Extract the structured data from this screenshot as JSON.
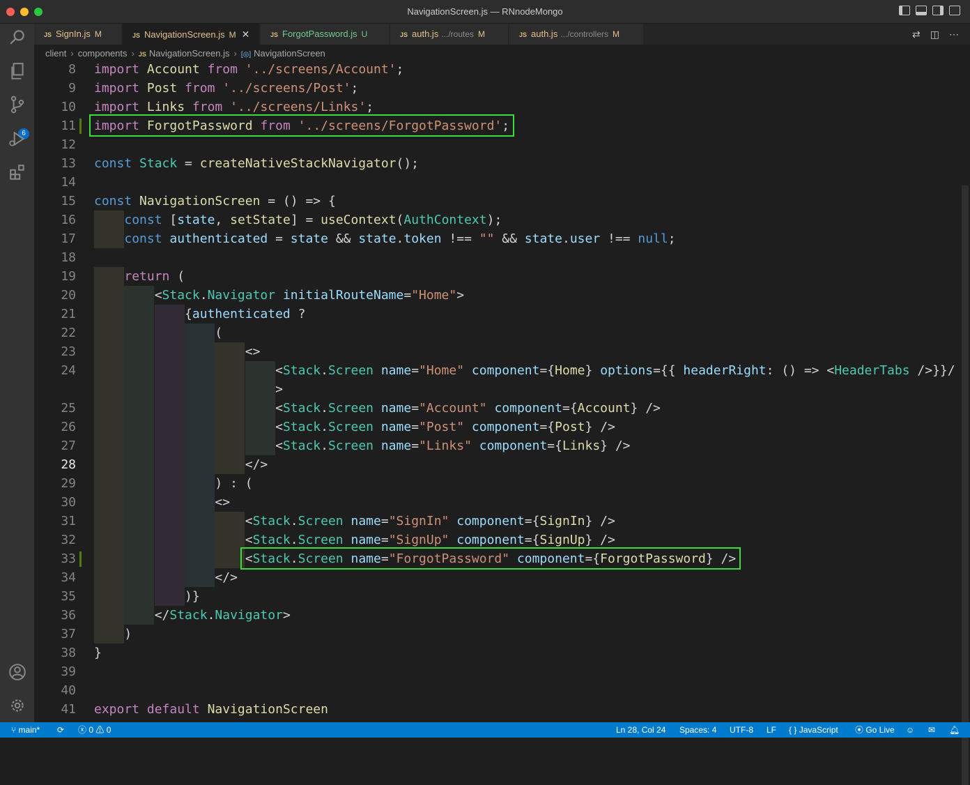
{
  "window": {
    "title": "NavigationScreen.js — RNnodeMongo"
  },
  "activity": {
    "scm_badge": "6"
  },
  "tabs": [
    {
      "name": "SignIn.js",
      "dir": "",
      "status": "M"
    },
    {
      "name": "NavigationScreen.js",
      "dir": "",
      "status": "M"
    },
    {
      "name": "ForgotPassword.js",
      "dir": "",
      "status": "U"
    },
    {
      "name": "auth.js",
      "dir": ".../routes",
      "status": "M"
    },
    {
      "name": "auth.js",
      "dir": ".../controllers",
      "status": "M"
    }
  ],
  "breadcrumb": {
    "folder1": "client",
    "folder2": "components",
    "file": "NavigationScreen.js",
    "symbol": "NavigationScreen"
  },
  "editor": {
    "line_numbers": [
      "8",
      "9",
      "10",
      "11",
      "12",
      "13",
      "14",
      "15",
      "16",
      "17",
      "18",
      "19",
      "20",
      "21",
      "22",
      "23",
      "24",
      "",
      "25",
      "26",
      "27",
      "28",
      "29",
      "30",
      "31",
      "32",
      "33",
      "34",
      "35",
      "36",
      "37",
      "38",
      "39",
      "40",
      "41"
    ],
    "lines": [
      "import Account from '../screens/Account';",
      "import Post from '../screens/Post';",
      "import Links from '../screens/Links';",
      "import ForgotPassword from '../screens/ForgotPassword';",
      "",
      "const Stack = createNativeStackNavigator();",
      "",
      "const NavigationScreen = () => {",
      "    const [state, setState] = useContext(AuthContext);",
      "    const authenticated = state && state.token !== \"\" && state.user !== null;",
      "",
      "    return (",
      "        <Stack.Navigator initialRouteName=\"Home\">",
      "            {authenticated ?",
      "                (",
      "                    <>",
      "                        <Stack.Screen name=\"Home\" component={Home} options={{ headerRight: () => <HeaderTabs />}}/",
      "                        >",
      "                        <Stack.Screen name=\"Account\" component={Account} />",
      "                        <Stack.Screen name=\"Post\" component={Post} />",
      "                        <Stack.Screen name=\"Links\" component={Links} />",
      "                    </>",
      "                ) : (",
      "                <>",
      "                    <Stack.Screen name=\"SignIn\" component={SignIn} />",
      "                    <Stack.Screen name=\"SignUp\" component={SignUp} />",
      "                    <Stack.Screen name=\"ForgotPassword\" component={ForgotPassword} />",
      "                </>",
      "            )}",
      "        </Stack.Navigator>",
      "    )",
      "}",
      "",
      "",
      "export default NavigationScreen"
    ]
  },
  "statusbar": {
    "branch": "main*",
    "errors": "0",
    "warnings": "0",
    "position": "Ln 28, Col 24",
    "spaces": "Spaces: 4",
    "encoding": "UTF-8",
    "eol": "LF",
    "language": "JavaScript",
    "golive": "Go Live"
  },
  "colors": {
    "accent": "#007acc",
    "highlight_box": "#3bdc3b",
    "modified": "#e2c08d",
    "untracked": "#73c991"
  }
}
